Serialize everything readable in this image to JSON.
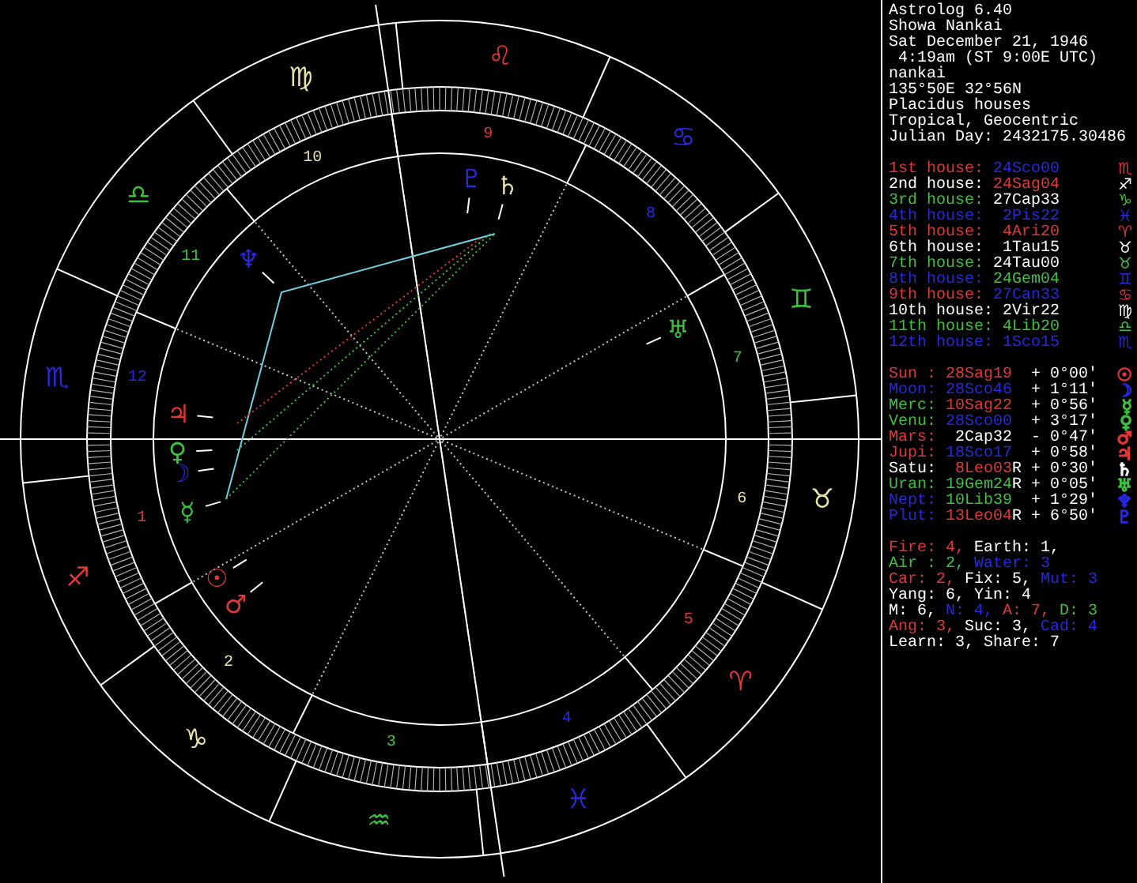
{
  "chart": {
    "signs": [
      {
        "glyph": "♈",
        "color": "#e03838"
      },
      {
        "glyph": "♉",
        "color": "#e8e4a8"
      },
      {
        "glyph": "♊",
        "color": "#40c040"
      },
      {
        "glyph": "♋",
        "color": "#2828e0"
      },
      {
        "glyph": "♌",
        "color": "#e03838"
      },
      {
        "glyph": "♍",
        "color": "#e8e4a8"
      },
      {
        "glyph": "♎",
        "color": "#40c040"
      },
      {
        "glyph": "♏",
        "color": "#2828e0"
      },
      {
        "glyph": "♐",
        "color": "#e03838"
      },
      {
        "glyph": "♑",
        "color": "#e8e4a8"
      },
      {
        "glyph": "♒",
        "color": "#40c040"
      },
      {
        "glyph": "♓",
        "color": "#2828e0"
      }
    ],
    "houses": [
      {
        "number": "1",
        "color": "#e03838"
      },
      {
        "number": "2",
        "color": "#e8e4a8"
      },
      {
        "number": "3",
        "color": "#40c040"
      },
      {
        "number": "4",
        "color": "#2828e0"
      },
      {
        "number": "5",
        "color": "#e03838"
      },
      {
        "number": "6",
        "color": "#e8e4a8"
      },
      {
        "number": "7",
        "color": "#40c040"
      },
      {
        "number": "8",
        "color": "#2828e0"
      },
      {
        "number": "9",
        "color": "#e03838"
      },
      {
        "number": "10",
        "color": "#e8e4a8"
      },
      {
        "number": "11",
        "color": "#40c040"
      },
      {
        "number": "12",
        "color": "#2828e0"
      }
    ],
    "planets": [
      {
        "glyph": "☉",
        "color": "#e03838"
      },
      {
        "glyph": "☽",
        "color": "#2828e0"
      },
      {
        "glyph": "☿",
        "color": "#40c040"
      },
      {
        "glyph": "♀",
        "color": "#40c040"
      },
      {
        "glyph": "♂",
        "color": "#e03838"
      },
      {
        "glyph": "♃",
        "color": "#e03838"
      },
      {
        "glyph": "♄",
        "color": "#e8e4a8"
      },
      {
        "glyph": "♅",
        "color": "#40c040"
      },
      {
        "glyph": "♆",
        "color": "#2828e0"
      },
      {
        "glyph": "♇",
        "color": "#2828e0"
      }
    ]
  },
  "info_panel": {
    "header": [
      "Astrolog 6.40",
      "Showa Nankai",
      "Sat December 21, 1946",
      " 4:19am (ST 9:00E UTC)",
      "nankai",
      "135°50E 32°56N",
      "Placidus houses",
      "Tropical, Geocentric",
      "Julian Day: 2432175.30486"
    ],
    "house_cusps": [
      {
        "label": {
          "text": "1st house:",
          "color": "#e03838"
        },
        "value": {
          "text": "24Sco00",
          "color": "#2828e0"
        },
        "glyph": {
          "text": "♏",
          "color": "#e03838"
        }
      },
      {
        "label": {
          "text": "2nd house:",
          "color": "#ffffff"
        },
        "value": {
          "text": "24Sag04",
          "color": "#e03838"
        },
        "glyph": {
          "text": "♐",
          "color": "#ffffff"
        }
      },
      {
        "label": {
          "text": "3rd house:",
          "color": "#40c040"
        },
        "value": {
          "text": "27Cap33",
          "color": "#ffffff"
        },
        "glyph": {
          "text": "♑",
          "color": "#40c040"
        }
      },
      {
        "label": {
          "text": "4th house:",
          "color": "#2828e0"
        },
        "value": {
          "text": "2Pis22",
          "color": "#2828e0"
        },
        "glyph": {
          "text": "♓",
          "color": "#2828e0"
        }
      },
      {
        "label": {
          "text": "5th house:",
          "color": "#e03838"
        },
        "value": {
          "text": "4Ari20",
          "color": "#e03838"
        },
        "glyph": {
          "text": "♈",
          "color": "#e03838"
        }
      },
      {
        "label": {
          "text": "6th house:",
          "color": "#ffffff"
        },
        "value": {
          "text": "1Tau15",
          "color": "#ffffff"
        },
        "glyph": {
          "text": "♉",
          "color": "#ffffff"
        }
      },
      {
        "label": {
          "text": "7th house:",
          "color": "#40c040"
        },
        "value": {
          "text": "24Tau00",
          "color": "#ffffff"
        },
        "glyph": {
          "text": "♉",
          "color": "#40c040"
        }
      },
      {
        "label": {
          "text": "8th house:",
          "color": "#2828e0"
        },
        "value": {
          "text": "24Gem04",
          "color": "#40c040"
        },
        "glyph": {
          "text": "♊",
          "color": "#2828e0"
        }
      },
      {
        "label": {
          "text": "9th house:",
          "color": "#e03838"
        },
        "value": {
          "text": "27Can33",
          "color": "#2828e0"
        },
        "glyph": {
          "text": "♋",
          "color": "#e03838"
        }
      },
      {
        "label": {
          "text": "10th house:",
          "color": "#ffffff"
        },
        "value": {
          "text": "2Vir22",
          "color": "#ffffff"
        },
        "glyph": {
          "text": "♍",
          "color": "#ffffff"
        }
      },
      {
        "label": {
          "text": "11th house:",
          "color": "#40c040"
        },
        "value": {
          "text": "4Lib20",
          "color": "#40c040"
        },
        "glyph": {
          "text": "♎",
          "color": "#40c040"
        }
      },
      {
        "label": {
          "text": "12th house:",
          "color": "#2828e0"
        },
        "value": {
          "text": "1Sco15",
          "color": "#2828e0"
        },
        "glyph": {
          "text": "♏",
          "color": "#2828e0"
        }
      }
    ],
    "planets": [
      {
        "name": {
          "text": "Sun :",
          "color": "#e03838"
        },
        "position": {
          "text": "28Sag19",
          "color": "#e03838"
        },
        "aspect": "+ 0°00'",
        "glyph": {
          "text": "☉",
          "color": "#e03838"
        }
      },
      {
        "name": {
          "text": "Moon:",
          "color": "#2828e0"
        },
        "position": {
          "text": "28Sco46",
          "color": "#2828e0"
        },
        "aspect": "+ 1°11'",
        "glyph": {
          "text": "☽",
          "color": "#2828e0"
        }
      },
      {
        "name": {
          "text": "Merc:",
          "color": "#40c040"
        },
        "position": {
          "text": "10Sag22",
          "color": "#e03838"
        },
        "aspect": "+ 0°56'",
        "glyph": {
          "text": "☿",
          "color": "#40c040"
        }
      },
      {
        "name": {
          "text": "Venu:",
          "color": "#40c040"
        },
        "position": {
          "text": "28Sco00",
          "color": "#2828e0"
        },
        "aspect": "+ 3°17'",
        "glyph": {
          "text": "♀",
          "color": "#40c040"
        }
      },
      {
        "name": {
          "text": "Mars:",
          "color": "#e03838"
        },
        "position": {
          "text": "2Cap32",
          "color": "#ffffff"
        },
        "aspect": "- 0°47'",
        "glyph": {
          "text": "♂",
          "color": "#e03838"
        }
      },
      {
        "name": {
          "text": "Jupi:",
          "color": "#e03838"
        },
        "position": {
          "text": "18Sco17",
          "color": "#2828e0"
        },
        "aspect": "+ 0°58'",
        "glyph": {
          "text": "♃",
          "color": "#e03838"
        }
      },
      {
        "name": {
          "text": "Satu:",
          "color": "#ffffff"
        },
        "position": {
          "text": "8Leo03",
          "color": "#e03838"
        },
        "retro_mark": "R",
        "aspect": "+ 0°30'",
        "glyph": {
          "text": "♄",
          "color": "#ffffff"
        }
      },
      {
        "name": {
          "text": "Uran:",
          "color": "#40c040"
        },
        "position": {
          "text": "19Gem24",
          "color": "#40c040"
        },
        "retro_mark": "R",
        "aspect": "+ 0°05'",
        "glyph": {
          "text": "♅",
          "color": "#40c040"
        }
      },
      {
        "name": {
          "text": "Nept:",
          "color": "#2828e0"
        },
        "position": {
          "text": "10Lib39",
          "color": "#40c040"
        },
        "aspect": "+ 1°29'",
        "glyph": {
          "text": "♆",
          "color": "#2828e0"
        }
      },
      {
        "name": {
          "text": "Plut:",
          "color": "#2828e0"
        },
        "position": {
          "text": "13Leo04",
          "color": "#e03838"
        },
        "retro_mark": "R",
        "aspect": "+ 6°50'",
        "glyph": {
          "text": "♇",
          "color": "#2828e0"
        }
      }
    ],
    "summary": [
      [
        {
          "text": "Fire: 4,",
          "color": "#e03838"
        },
        {
          "text": "Earth: 1,",
          "color": "#ffffff"
        }
      ],
      [
        {
          "text": "Air : 2,",
          "color": "#40c040"
        },
        {
          "text": "Water: 3",
          "color": "#2828e0"
        }
      ],
      [
        {
          "text": "Car: 2,",
          "color": "#e03838"
        },
        {
          "text": "Fix: 5,",
          "color": "#ffffff"
        },
        {
          "text": "Mut: 3",
          "color": "#2828e0"
        }
      ],
      [
        {
          "text": "Yang: 6, Yin: 4",
          "color": "#ffffff"
        }
      ],
      [
        {
          "text": "M: 6,",
          "color": "#ffffff"
        },
        {
          "text": "N: 4,",
          "color": "#2828e0"
        },
        {
          "text": "A: 7,",
          "color": "#e03838"
        },
        {
          "text": "D: 3",
          "color": "#40c040"
        }
      ],
      [
        {
          "text": "Ang: 3,",
          "color": "#e03838"
        },
        {
          "text": "Suc: 3,",
          "color": "#ffffff"
        },
        {
          "text": "Cad: 4",
          "color": "#2828e0"
        }
      ],
      [
        {
          "text": "Learn: 3, Share: 7",
          "color": "#ffffff"
        }
      ]
    ]
  }
}
